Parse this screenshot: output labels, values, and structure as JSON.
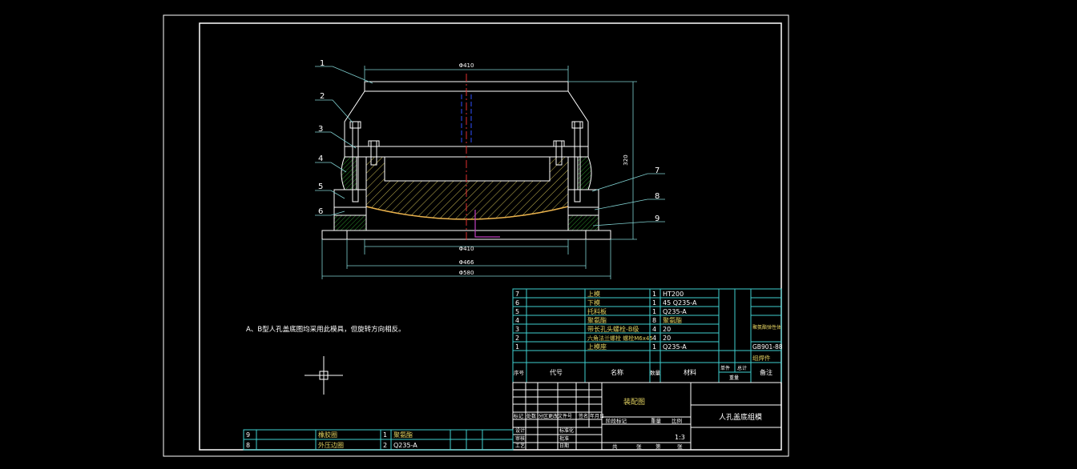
{
  "drawing": {
    "note": "A、B型人孔盖底图均采用此模具，但旋转方向相反。",
    "title": "人孔盖底组模",
    "assembly_label": "装配图",
    "scale": "1:3",
    "dimensions": {
      "top_width": "Φ410",
      "height": "320",
      "inner_width": "Φ410",
      "mid_width": "Φ466",
      "base_width": "Φ580"
    },
    "callouts": [
      "1",
      "2",
      "3",
      "4",
      "5",
      "6",
      "7",
      "8",
      "9"
    ]
  },
  "bom": {
    "header": {
      "no": "序号",
      "code": "代号",
      "name": "名称",
      "qty": "数量",
      "material": "材料",
      "unit_w": "单件",
      "total_w": "总计",
      "weight": "重量",
      "remark": "备注"
    },
    "rows": [
      {
        "no": "7",
        "name": "上模",
        "qty": "1",
        "material": "HT200",
        "remark": ""
      },
      {
        "no": "6",
        "name": "下模",
        "qty": "1",
        "material": "45  Q235-A",
        "remark": ""
      },
      {
        "no": "5",
        "name": "托料板",
        "qty": "1",
        "material": "Q235-A",
        "remark": ""
      },
      {
        "no": "4",
        "name": "聚氨酯",
        "qty": "8",
        "material": "聚氨酯",
        "remark": "聚氨酯弹性体"
      },
      {
        "no": "3",
        "name": "带长孔头螺栓-B级",
        "qty": "4",
        "material": "20",
        "remark": ""
      },
      {
        "no": "2",
        "name": "六角法兰螺栓 螺栓M6x45",
        "qty": "4",
        "material": "20",
        "remark": "GB901-88"
      },
      {
        "no": "1",
        "name": "上模座",
        "qty": "1",
        "material": "Q235-A",
        "remark": "组焊件"
      }
    ],
    "lower_rows": [
      {
        "no": "9",
        "name": "橡胶圈",
        "qty": "1",
        "material": "聚氨酯"
      },
      {
        "no": "8",
        "name": "外压边圈",
        "qty": "2",
        "material": "Q235-A"
      }
    ]
  },
  "title_block": {
    "row_labels": [
      "标记",
      "处数",
      "分区",
      "更改文件号",
      "签名",
      "年月日"
    ],
    "roles": [
      "设计",
      "审核",
      "工艺"
    ],
    "roles2": [
      "标准化",
      "批准",
      "日期"
    ],
    "stage_labels": [
      "阶段标记",
      "重量",
      "比例"
    ],
    "sheet_labels": [
      "共",
      "张",
      "第",
      "张"
    ]
  }
}
